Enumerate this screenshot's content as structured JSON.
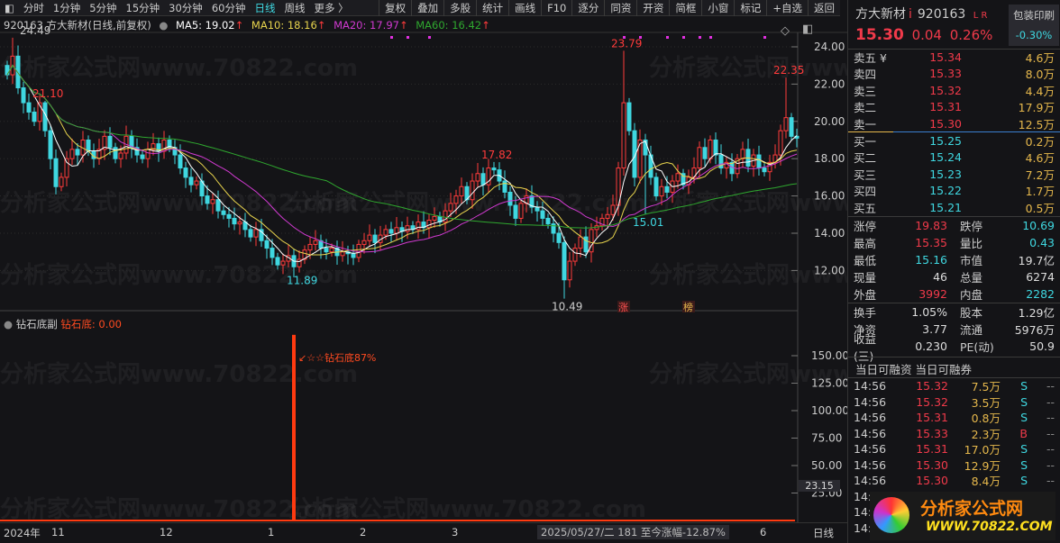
{
  "toolbar": {
    "periods": [
      "分时",
      "1分钟",
      "5分钟",
      "15分钟",
      "30分钟",
      "60分钟",
      "日线",
      "周线",
      "更多 〉"
    ],
    "active": "日线",
    "buttons": [
      "复权",
      "叠加",
      "多股",
      "统计",
      "画线",
      "F10",
      "逐分",
      "同资",
      "开资",
      "简框",
      "小窗",
      "标记",
      "+自选",
      "返回"
    ]
  },
  "info": {
    "title": "920163 方大新材(日线,前复权)",
    "ma5": "MA5: 19.02",
    "ma10": "MA10: 18.16",
    "ma20": "MA20: 17.97",
    "ma60": "MA60: 16.42",
    "arrow": "↑"
  },
  "colors": {
    "up": "#ff3b3b",
    "down": "#3fd7e0",
    "ma5": "#ffffff",
    "ma10": "#e8d44d",
    "ma20": "#d03ad0",
    "ma60": "#2fa82f",
    "signal": "#ff3a10"
  },
  "chart_data": {
    "type": "candlestick",
    "y_ticks": [
      "24.00",
      "22.00",
      "20.00",
      "18.00",
      "16.00",
      "14.00",
      "12.00"
    ],
    "ylim": [
      10,
      25
    ],
    "first_open": 23.0,
    "closes": [
      22.5,
      23.5,
      21.8,
      21.0,
      20.5,
      20.0,
      21.0,
      19.5,
      18.0,
      16.5,
      17.0,
      18.0,
      18.5,
      18.2,
      19.0,
      18.4,
      18.0,
      18.5,
      19.2,
      18.6,
      18.0,
      18.3,
      19.2,
      18.6,
      18.2,
      18.0,
      18.5,
      18.8,
      18.4,
      19.0,
      18.6,
      18.2,
      17.5,
      17.0,
      16.6,
      16.8,
      16.0,
      15.6,
      15.8,
      15.2,
      15.0,
      14.8,
      14.5,
      14.6,
      14.2,
      13.8,
      14.2,
      13.6,
      13.2,
      12.7,
      12.3,
      12.5,
      12.8,
      12.2,
      12.6,
      13.1,
      13.4,
      13.6,
      13.2,
      13.0,
      13.2,
      12.8,
      13.0,
      12.9,
      12.7,
      13.4,
      13.6,
      13.9,
      13.5,
      13.9,
      14.2,
      14.0,
      14.3,
      14.1,
      14.4,
      14.2,
      14.6,
      14.3,
      14.7,
      14.9,
      14.6,
      15.2,
      15.6,
      16.0,
      16.5,
      15.8,
      16.8,
      17.2,
      16.6,
      17.5,
      17.4,
      16.8,
      16.2,
      15.5,
      14.8,
      15.6,
      16.0,
      15.4,
      15.2,
      14.8,
      14.5,
      14.0,
      13.5,
      11.5,
      12.5,
      13.2,
      13.8,
      13.0,
      14.2,
      14.4,
      14.8,
      15.0,
      15.5,
      17.5,
      21.0,
      19.5,
      17.0,
      19.0,
      18.2,
      17.0,
      16.0,
      16.5,
      16.2,
      16.8,
      17.2,
      16.6,
      17.0,
      17.5,
      18.6,
      18.0,
      19.0,
      18.2,
      17.5,
      17.8,
      17.2,
      18.0,
      18.5,
      17.6,
      18.2,
      17.5,
      17.3,
      17.8,
      18.2,
      19.5,
      20.2,
      19.2,
      19.1
    ],
    "annotations": [
      {
        "index": 1,
        "price": 24.49,
        "text": "24.49",
        "kind": "high"
      },
      {
        "index": 7,
        "price": 21.1,
        "text": "21.10",
        "kind": "high"
      },
      {
        "index": 54,
        "price": 11.89,
        "text": "11.89",
        "kind": "low"
      },
      {
        "index": 90,
        "price": 17.82,
        "text": "17.82",
        "kind": "high"
      },
      {
        "index": 103,
        "price": 10.49,
        "text": "10.49",
        "kind": "low"
      },
      {
        "index": 114,
        "price": 23.79,
        "text": "23.79",
        "kind": "high"
      },
      {
        "index": 118,
        "price": 15.01,
        "text": "15.01",
        "kind": "low"
      },
      {
        "index": 144,
        "price": 22.35,
        "text": "22.35",
        "kind": "high"
      }
    ],
    "signal_dots": [
      71,
      74,
      78,
      114,
      117,
      122,
      125,
      128,
      130,
      140
    ],
    "markers": [
      {
        "index": 114,
        "text": "涨"
      },
      {
        "index": 126,
        "text": "榜"
      }
    ],
    "months": [
      {
        "index": 8,
        "text": "11"
      },
      {
        "index": 28,
        "text": "12"
      },
      {
        "index": 48,
        "text": "1"
      },
      {
        "index": 65,
        "text": "2"
      },
      {
        "index": 82,
        "text": "3"
      },
      {
        "index": 139,
        "text": "6"
      }
    ]
  },
  "sub": {
    "name": "钻石底副",
    "value_label": "钻石底: 0.00",
    "signal_text": "↙☆☆钻石底87%",
    "signal_index": 53,
    "signal_value": 169,
    "y_ticks": [
      "150.00",
      "125.00",
      "100.00",
      "75.00",
      "50.00",
      "25.00"
    ],
    "current": "23.15"
  },
  "timeaxis": {
    "year": "2024年",
    "status": "2025/05/27/二 181 至今涨幅-12.87%",
    "period": "日线"
  },
  "quote": {
    "name": "方大新材",
    "flag": "i",
    "code": "920163",
    "lr": "L R",
    "price": "15.30",
    "change": "0.04",
    "pct": "0.26%",
    "sector": "包装印刷",
    "sector_pct": "-0.30%"
  },
  "asks": [
    {
      "l": "卖五 ¥",
      "p": "15.34",
      "v": "4.6万"
    },
    {
      "l": "卖四",
      "p": "15.33",
      "v": "8.0万"
    },
    {
      "l": "卖三",
      "p": "15.32",
      "v": "4.4万"
    },
    {
      "l": "卖二",
      "p": "15.31",
      "v": "17.9万"
    },
    {
      "l": "卖一",
      "p": "15.30",
      "v": "12.5万"
    }
  ],
  "bids": [
    {
      "l": "买一",
      "p": "15.25",
      "v": "0.2万"
    },
    {
      "l": "买二",
      "p": "15.24",
      "v": "4.6万"
    },
    {
      "l": "买三",
      "p": "15.23",
      "v": "7.2万"
    },
    {
      "l": "买四",
      "p": "15.22",
      "v": "1.7万"
    },
    {
      "l": "买五",
      "p": "15.21",
      "v": "0.5万"
    }
  ],
  "stats": [
    [
      "涨停",
      "19.83",
      "跌停",
      "10.69"
    ],
    [
      "最高",
      "15.35",
      "量比",
      "0.43"
    ],
    [
      "最低",
      "15.16",
      "市值",
      "19.7亿"
    ],
    [
      "现量",
      "46",
      "总量",
      "6274"
    ],
    [
      "外盘",
      "3992",
      "内盘",
      "2282"
    ]
  ],
  "stats2": [
    [
      "换手",
      "1.05%",
      "股本",
      "1.29亿"
    ],
    [
      "净资",
      "3.77",
      "流通",
      "5976万"
    ],
    [
      "收益(三)",
      "0.230",
      "PE(动)",
      "50.9"
    ]
  ],
  "margin": {
    "a": "当日可融资",
    "b": "当日可融券"
  },
  "trades": [
    [
      "14:56",
      "15.32",
      "7.5万",
      "S",
      "--"
    ],
    [
      "14:56",
      "15.32",
      "3.5万",
      "S",
      "--"
    ],
    [
      "14:56",
      "15.31",
      "0.8万",
      "S",
      "--"
    ],
    [
      "14:56",
      "15.33",
      "2.3万",
      "B",
      "--"
    ],
    [
      "14:56",
      "15.31",
      "17.0万",
      "S",
      "--"
    ],
    [
      "14:56",
      "15.30",
      "12.9万",
      "S",
      "--"
    ],
    [
      "14:56",
      "15.30",
      "8.4万",
      "S",
      "--"
    ],
    [
      "14:",
      "",
      "",
      "",
      ""
    ],
    [
      "14:",
      "",
      "",
      "",
      ""
    ],
    [
      "14:",
      "",
      "",
      "",
      ""
    ]
  ],
  "watermark": "分析家公式网www.70822.com",
  "logo": {
    "title": "分析家公式网",
    "url": "WWW.70822.COM"
  }
}
